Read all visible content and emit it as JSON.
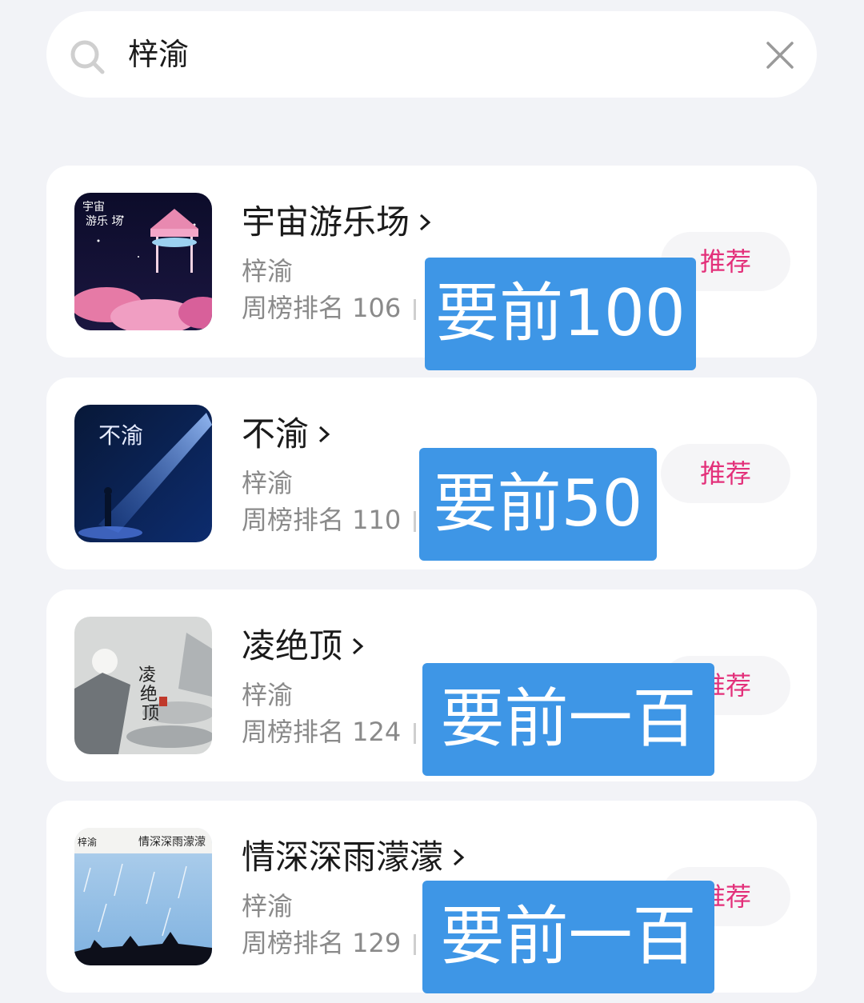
{
  "search": {
    "query": "梓渝",
    "icon": "search-icon",
    "clear_icon": "close-icon"
  },
  "songs": [
    {
      "title": "宇宙游乐场",
      "artist": "梓渝",
      "rank_label": "周榜排名 106",
      "recommend": "推荐",
      "overlay": "要前100"
    },
    {
      "title": "不渝",
      "artist": "梓渝",
      "rank_label": "周榜排名 110",
      "recommend": "推荐",
      "overlay": "要前50"
    },
    {
      "title": "凌绝顶",
      "artist": "梓渝",
      "rank_label": "周榜排名 124",
      "recommend": "推荐",
      "overlay": "要前一百"
    },
    {
      "title": "情深深雨濛濛",
      "artist": "梓渝",
      "rank_label": "周榜排名 129",
      "recommend": "推荐",
      "overlay": "要前一百"
    }
  ],
  "colors": {
    "background": "#f2f3f7",
    "recommend_text": "#e3307a",
    "overlay_bg": "#3e96e6"
  }
}
